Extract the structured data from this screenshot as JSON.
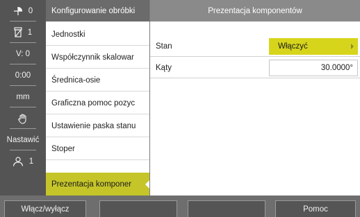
{
  "statusbar": {
    "items": [
      {
        "icon": "datum-axis-icon",
        "label": "0"
      },
      {
        "icon": "tool-icon",
        "label": "1"
      },
      {
        "icon": "",
        "label": "V: 0"
      },
      {
        "icon": "",
        "label": "0:00"
      },
      {
        "icon": "",
        "label": "mm"
      },
      {
        "icon": "hand-icon",
        "label": ""
      },
      {
        "icon": "",
        "label": "Nastawić"
      },
      {
        "icon": "user-icon",
        "label": "1"
      }
    ]
  },
  "menu": {
    "title": "Konfigurowanie obróbki",
    "items": [
      {
        "label": "Jednostki"
      },
      {
        "label": "Współczynnik skalowar"
      },
      {
        "label": "Średnica-osie"
      },
      {
        "label": "Graficzna pomoc pozyc"
      },
      {
        "label": "Ustawienie paska stanu"
      },
      {
        "label": "Stoper"
      },
      {
        "label": "Prezentacja komponer"
      }
    ],
    "active_index": 6
  },
  "content": {
    "title": "Prezentacja komponentów",
    "rows": [
      {
        "label": "Stan",
        "value": "Włączyć",
        "type": "select"
      },
      {
        "label": "Kąty",
        "value": "30.0000°",
        "type": "input"
      }
    ]
  },
  "softkeys": [
    {
      "label": "Włącz/wyłącz"
    },
    {
      "label": ""
    },
    {
      "label": ""
    },
    {
      "label": "Pomoc"
    }
  ],
  "colors": {
    "accent": "#c5c52a",
    "select": "#d6d51c",
    "statusbar_bg": "#545454",
    "header_bg": "#8a8a8a"
  }
}
